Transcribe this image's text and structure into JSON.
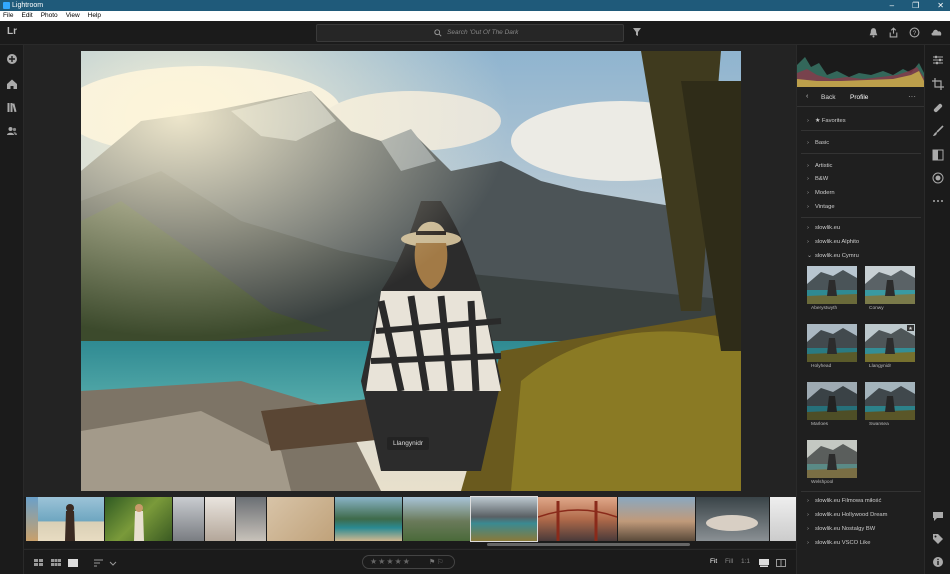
{
  "window": {
    "title": "Lightroom",
    "controls": [
      "–",
      "❐",
      "✕"
    ]
  },
  "menu": [
    "File",
    "Edit",
    "Photo",
    "View",
    "Help"
  ],
  "topbar": {
    "logo": "Lr",
    "search_placeholder": "Search 'Out Of The Dark"
  },
  "photo": {
    "preset_overlay_label": "Llangynidr"
  },
  "panel": {
    "back_label": "Back",
    "title": "Profile",
    "more": "···",
    "groups_top": [
      {
        "label": "Favorites",
        "star": "★"
      },
      {
        "label": "Basic"
      }
    ],
    "groups_standard": [
      "Artistic",
      "B&W",
      "Modern",
      "Vintage"
    ],
    "groups_custom": [
      "slowlik.eu",
      "slowlik.eu Alphito",
      "slowlik.eu Cymru"
    ],
    "presets": [
      "Aberystwyth",
      "Conwy",
      "Holyhead",
      "Llangynidr",
      "Marloes",
      "Swansea",
      "Welshpool"
    ],
    "groups_bottom": [
      "slowlik.eu Filmowa miłość",
      "slowlik.eu Hollywood Dream",
      "slowlik.eu Nostalgy BW",
      "slowlik.eu VSCO Like"
    ]
  },
  "bottombar": {
    "stars": "★★★★★",
    "flags": "⚑ ⚐",
    "zoom_fit": "Fit",
    "zoom_fill": "Fill",
    "zoom_1to1": "1:1"
  },
  "icons": {
    "left_rail": [
      "add-icon",
      "home-icon",
      "library-icon",
      "people-icon"
    ],
    "top_right": [
      "bell-icon",
      "share-icon",
      "help-icon",
      "cloud-icon"
    ],
    "right_rail": [
      "sliders-icon",
      "crop-icon",
      "heal-icon",
      "brush-icon",
      "gradient-icon",
      "radial-icon",
      "more-icon",
      "comment-icon",
      "tag-icon",
      "info-icon"
    ]
  },
  "colors": {
    "titlebar": "#1f5a7a",
    "accent": "#31a8ff"
  }
}
